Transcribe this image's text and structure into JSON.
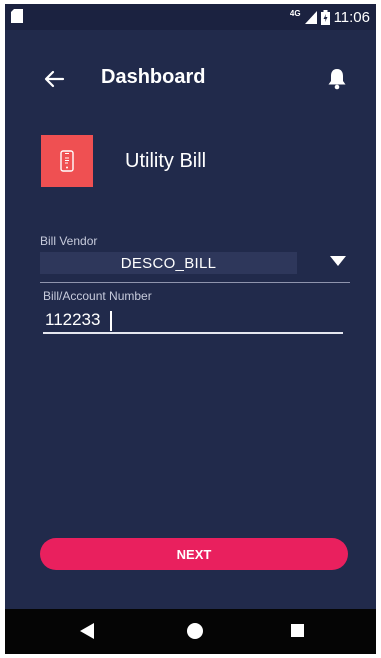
{
  "status_bar": {
    "network": "4G",
    "time": "11:06"
  },
  "header": {
    "title": "Dashboard",
    "back_icon": "arrow-left-icon",
    "notification_icon": "bell-icon"
  },
  "utility": {
    "title": "Utility Bill",
    "icon": "phone-bill-icon",
    "tile_color": "#ef5052"
  },
  "form": {
    "vendor_label": "Bill Vendor",
    "vendor_value": "DESCO_BILL",
    "account_label": "Bill/Account Number",
    "account_value": "112233"
  },
  "actions": {
    "next_label": "NEXT",
    "next_color": "#e9205e"
  },
  "nav_bar": {
    "back_icon": "nav-back-icon",
    "home_icon": "nav-home-icon",
    "recents_icon": "nav-recents-icon"
  },
  "theme": {
    "background": "#212a4b"
  }
}
